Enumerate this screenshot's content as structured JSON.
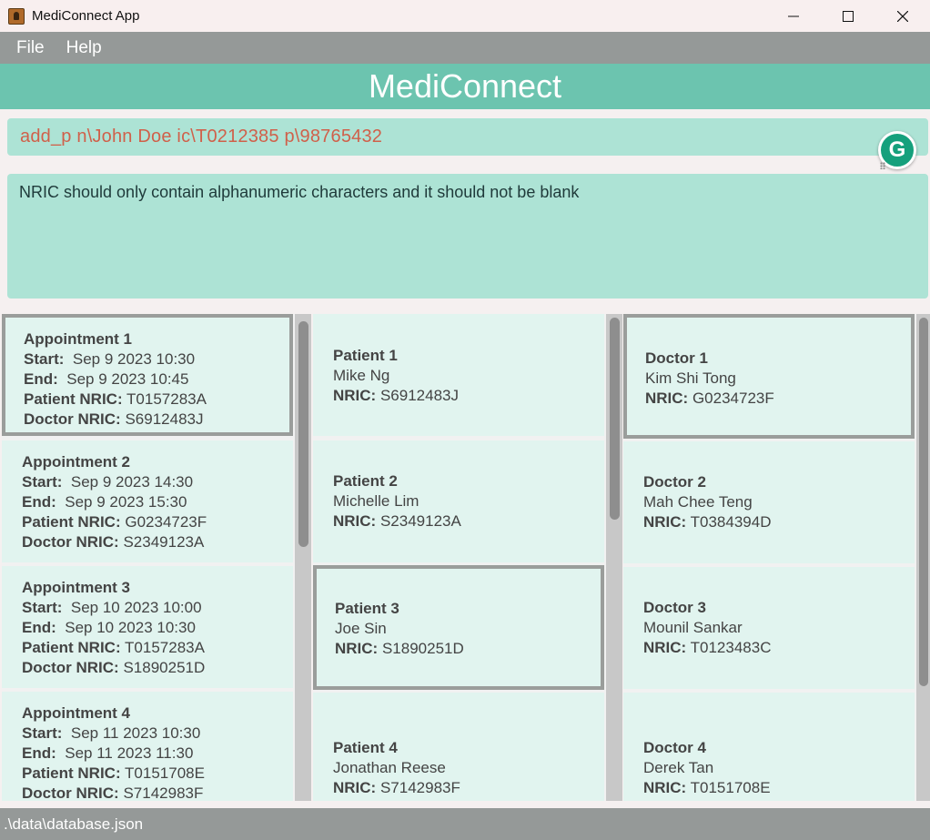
{
  "window": {
    "title": "MediConnect App",
    "controls": {
      "minimize": "—",
      "maximize": "☐",
      "close": "✕"
    }
  },
  "menu": {
    "file": "File",
    "help": "Help"
  },
  "header": {
    "title": "MediConnect"
  },
  "command": {
    "value": "add_p n\\John Doe ic\\T0212385 p\\98765432"
  },
  "grammarly": {
    "label": "G"
  },
  "result": {
    "message": "NRIC should only contain alphanumeric characters and it should not be blank"
  },
  "labels": {
    "start": "Start:",
    "end": "End:",
    "patient_nric": "Patient NRIC:",
    "doctor_nric": "Doctor NRIC:",
    "nric": "NRIC:"
  },
  "appointments": [
    {
      "title": "Appointment 1",
      "start": "Sep 9 2023 10:30",
      "end": "Sep 9 2023 10:45",
      "patient_nric": "T0157283A",
      "doctor_nric": "S6912483J"
    },
    {
      "title": "Appointment 2",
      "start": "Sep 9 2023 14:30",
      "end": "Sep 9 2023 15:30",
      "patient_nric": "G0234723F",
      "doctor_nric": "S2349123A"
    },
    {
      "title": "Appointment 3",
      "start": "Sep 10 2023 10:00",
      "end": "Sep 10 2023 10:30",
      "patient_nric": "T0157283A",
      "doctor_nric": "S1890251D"
    },
    {
      "title": "Appointment 4",
      "start": "Sep 11 2023 10:30",
      "end": "Sep 11 2023 11:30",
      "patient_nric": "T0151708E",
      "doctor_nric": "S7142983F"
    }
  ],
  "patients": [
    {
      "title": "Patient 1",
      "name": "Mike Ng",
      "nric": "S6912483J"
    },
    {
      "title": "Patient 2",
      "name": "Michelle Lim",
      "nric": "S2349123A"
    },
    {
      "title": "Patient 3",
      "name": "Joe Sin",
      "nric": "S1890251D"
    },
    {
      "title": "Patient 4",
      "name": "Jonathan Reese",
      "nric": "S7142983F"
    }
  ],
  "doctors": [
    {
      "title": "Doctor 1",
      "name": "Kim Shi Tong",
      "nric": "G0234723F"
    },
    {
      "title": "Doctor 2",
      "name": "Mah Chee Teng",
      "nric": "T0384394D"
    },
    {
      "title": "Doctor 3",
      "name": "Mounil Sankar",
      "nric": "T0123483C"
    },
    {
      "title": "Doctor 4",
      "name": "Derek Tan",
      "nric": "T0151708E"
    }
  ],
  "status": {
    "path": ".\\data\\database.json"
  },
  "colors": {
    "header": "#6cc4af",
    "command_text": "#d0604a",
    "input_bg": "#ade3d5",
    "card_bg": "#e1f4ef",
    "menubar": "#959998"
  }
}
